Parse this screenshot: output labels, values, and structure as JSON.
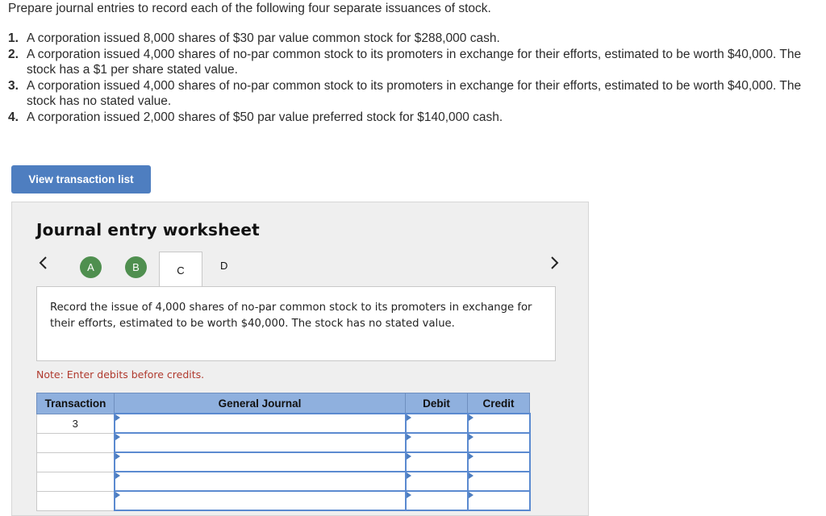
{
  "intro": "Prepare journal entries to record each of the following four separate issuances of stock.",
  "questions": [
    {
      "num": "1.",
      "text": "A corporation issued 8,000 shares of $30 par value common stock for $288,000 cash."
    },
    {
      "num": "2.",
      "text": "A corporation issued 4,000 shares of no-par common stock to its promoters in exchange for their efforts, estimated to be worth $40,000. The stock has a $1 per share stated value."
    },
    {
      "num": "3.",
      "text": "A corporation issued 4,000 shares of no-par common stock to its promoters in exchange for their efforts, estimated to be worth $40,000. The stock has no stated value."
    },
    {
      "num": "4.",
      "text": "A corporation issued 2,000 shares of $50 par value preferred stock for $140,000 cash."
    }
  ],
  "view_button": "View transaction list",
  "worksheet": {
    "title": "Journal entry worksheet",
    "prev_icon": "chevron-left-icon",
    "next_icon": "chevron-right-icon",
    "steps": [
      "A",
      "B",
      "C",
      "D"
    ],
    "active_step": "C",
    "completed_color": "#4f8f4f",
    "description": "Record the issue of 4,000 shares of no-par common stock to its promoters in exchange for their efforts, estimated to be worth $40,000. The stock has no stated value.",
    "note": "Note: Enter debits before credits."
  },
  "table": {
    "headers": [
      "Transaction",
      "General Journal",
      "Debit",
      "Credit"
    ],
    "rows": [
      {
        "transaction": "3",
        "account": "",
        "debit": "",
        "credit": ""
      },
      {
        "transaction": "",
        "account": "",
        "debit": "",
        "credit": ""
      },
      {
        "transaction": "",
        "account": "",
        "debit": "",
        "credit": ""
      },
      {
        "transaction": "",
        "account": "",
        "debit": "",
        "credit": ""
      },
      {
        "transaction": "",
        "account": "",
        "debit": "",
        "credit": ""
      }
    ],
    "header_color": "#8fb0de",
    "accent_color": "#4e7ec0"
  }
}
